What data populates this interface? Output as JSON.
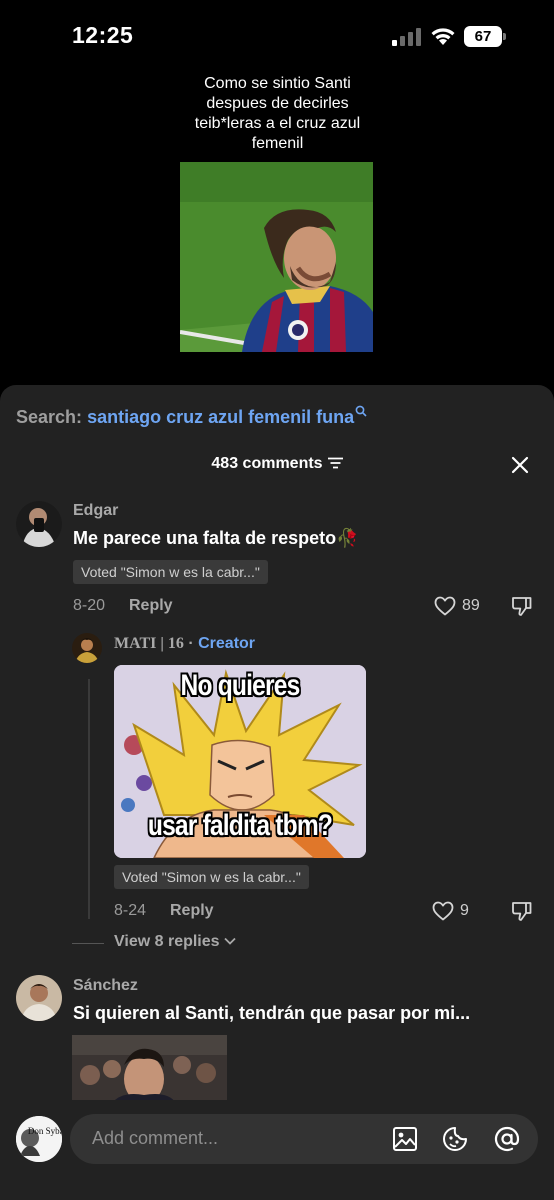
{
  "status_bar": {
    "time": "12:25",
    "battery": "67"
  },
  "video": {
    "caption": "Como se sintio Santi despues de decirles teib*leras a el cruz azul femenil"
  },
  "search": {
    "prefix": "Search:",
    "query": "santiago cruz azul femenil funa"
  },
  "comments_header": {
    "count_label": "483 comments"
  },
  "comments": [
    {
      "username": "Edgar",
      "text": "Me parece una falta de respeto🥀",
      "vote": "Voted \"Simon w es la cabr...\"",
      "date": "8-20",
      "reply_label": "Reply",
      "likes": "89"
    },
    {
      "username": "Sánchez",
      "text": "Si quieren al Santi, tendrán que pasar por mi..."
    }
  ],
  "reply": {
    "username": "MATI | 16",
    "separator": " · ",
    "creator_tag": "Creator",
    "sticker_top": "No quieres",
    "sticker_bottom": "usar faldita tbm?",
    "vote": "Voted \"Simon w es la cabr...\"",
    "date": "8-24",
    "reply_label": "Reply",
    "likes": "9"
  },
  "view_replies": "View 8 replies",
  "avatar_texts": {
    "own": "Don Sybau"
  },
  "input": {
    "placeholder": "Add comment..."
  },
  "colors": {
    "accent": "#6ea5f2",
    "sheet": "#222222",
    "input": "#333333"
  },
  "icons": [
    "signal-icon",
    "wifi-icon",
    "battery-icon",
    "search-icon",
    "sort-icon",
    "close-icon",
    "heart-icon",
    "dislike-icon",
    "chevron-down-icon",
    "image-icon",
    "emoji-icon",
    "mention-icon"
  ]
}
